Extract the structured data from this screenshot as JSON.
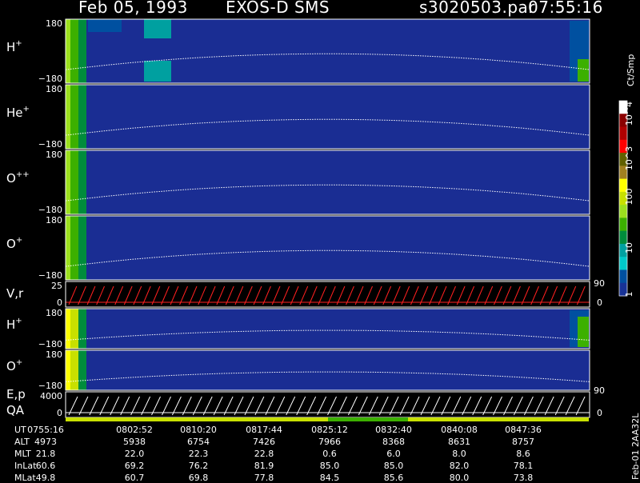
{
  "header": {
    "date": "Feb 05, 1993",
    "instrument": "EXOS-D SMS",
    "file": "s3020503.par",
    "time": "07:55:16"
  },
  "chart_data": [
    {
      "type": "heatmap",
      "panel": "H+",
      "label_main": "H",
      "label_sup": "+",
      "ylim": [
        -180,
        180
      ],
      "ticks_top": "180",
      "ticks_bottom": "−180"
    },
    {
      "type": "heatmap",
      "panel": "He+",
      "label_main": "He",
      "label_sup": "+",
      "ylim": [
        -180,
        180
      ],
      "ticks_top": "180",
      "ticks_bottom": "−180"
    },
    {
      "type": "heatmap",
      "panel": "O++",
      "label_main": "O",
      "label_sup": "++",
      "ylim": [
        -180,
        180
      ],
      "ticks_top": "180",
      "ticks_bottom": "−180"
    },
    {
      "type": "heatmap",
      "panel": "O+",
      "label_main": "O",
      "label_sup": "+",
      "ylim": [
        -180,
        180
      ],
      "ticks_top": "180",
      "ticks_bottom": "−180"
    },
    {
      "type": "line",
      "panel": "V,r",
      "label_main": "V,r",
      "ticks_top": "25",
      "ticks_bottom": "0",
      "right_top": "90",
      "right_bottom": "0"
    },
    {
      "type": "heatmap",
      "panel": "H+ (2)",
      "label_main": "H",
      "label_sup": "+",
      "ylim": [
        -180,
        180
      ],
      "ticks_top": "180",
      "ticks_bottom": "−180"
    },
    {
      "type": "heatmap",
      "panel": "O+ (2)",
      "label_main": "O",
      "label_sup": "+",
      "ylim": [
        -180,
        180
      ],
      "ticks_top": "180",
      "ticks_bottom": "−180"
    },
    {
      "type": "line",
      "panel": "E,p",
      "label_main": "E,p",
      "label_qa": "QA",
      "ticks_top": "4000",
      "ticks_bottom": "0",
      "right_top": "90",
      "right_bottom": "0"
    }
  ],
  "colorbar": {
    "unit": "Ct/Smp",
    "labels": [
      "10^4",
      "10^3",
      "100",
      "10",
      "1"
    ],
    "colors": [
      "#ffffff",
      "#8b0000",
      "#b00000",
      "#ff0000",
      "#606000",
      "#a08020",
      "#ffff00",
      "#c8e000",
      "#9be01e",
      "#3cb000",
      "#008c3c",
      "#00a0a0",
      "#00c8c8",
      "#0050a0",
      "#183296"
    ]
  },
  "table": {
    "rows": [
      {
        "label": "UT",
        "values": [
          "0755:16",
          "0802:52",
          "0810:20",
          "0817:44",
          "0825:12",
          "0832:40",
          "0840:08",
          "0847:36"
        ]
      },
      {
        "label": "ALT",
        "values": [
          "4973",
          "5938",
          "6754",
          "7426",
          "7966",
          "8368",
          "8631",
          "8757"
        ]
      },
      {
        "label": "MLT",
        "values": [
          "21.8",
          "22.0",
          "22.3",
          "22.8",
          "0.6",
          "6.0",
          "8.0",
          "8.6"
        ]
      },
      {
        "label": "InLat",
        "values": [
          "60.6",
          "69.2",
          "76.2",
          "81.9",
          "85.0",
          "85.0",
          "82.0",
          "78.1"
        ]
      },
      {
        "label": "MLat",
        "values": [
          "49.8",
          "60.7",
          "69.8",
          "77.8",
          "84.5",
          "85.6",
          "80.0",
          "73.8"
        ]
      }
    ],
    "footer_id": "Feb-01 2AA32L"
  }
}
